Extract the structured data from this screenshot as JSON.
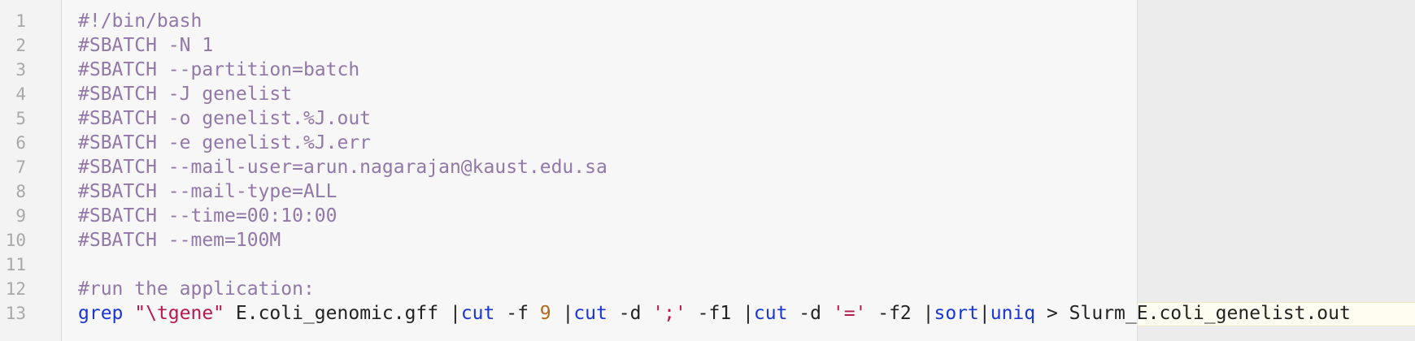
{
  "editor": {
    "line_numbers": [
      "1",
      "2",
      "3",
      "4",
      "5",
      "6",
      "7",
      "8",
      "9",
      "10",
      "11",
      "12",
      "13"
    ],
    "lines": [
      "#!/bin/bash",
      "#SBATCH -N 1",
      "#SBATCH --partition=batch",
      "#SBATCH -J genelist",
      "#SBATCH -o genelist.%J.out",
      "#SBATCH -e genelist.%J.err",
      "#SBATCH --mail-user=arun.nagarajan@kaust.edu.sa",
      "#SBATCH --mail-type=ALL",
      "#SBATCH --time=00:10:00",
      "#SBATCH --mem=100M",
      "",
      "#run the application:"
    ],
    "command": {
      "grep": "grep",
      "sp1": " ",
      "pattern": "\"\\tgene\"",
      "file": " E.coli_genomic.gff |",
      "cut1": "cut",
      "opt1": " -f ",
      "field1": "9",
      "pipe1": " |",
      "cut2": "cut",
      "opt2": " -d ",
      "delim1": "';'",
      "opt3": " -f1 |",
      "cut3": "cut",
      "opt4": " -d ",
      "delim2": "'='",
      "opt5": " -f2 |",
      "sort": "sort",
      "pipe2": "|",
      "uniq": "uniq",
      "redirect": " > Slurm_E.coli_genelist.out"
    }
  },
  "colors": {
    "comment": "#9178a8",
    "keyword": "#1a35d6",
    "string": "#b8184e",
    "number": "#b8661a",
    "line_number": "#a8a8a8",
    "current_line_bg": "#fffdf2"
  }
}
